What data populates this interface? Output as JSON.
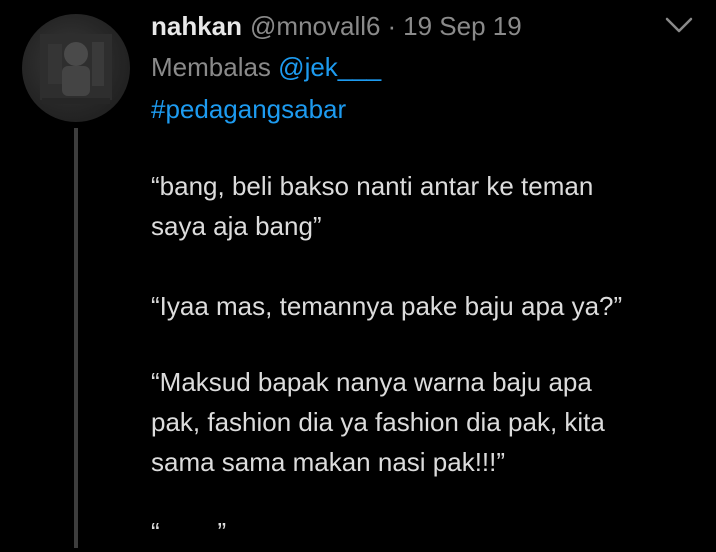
{
  "tweet": {
    "display_name": "nahkan",
    "handle": "@mnovall6",
    "separator": "·",
    "date": "19 Sep 19",
    "reply_prefix": "Membalas",
    "reply_to": "@jek___",
    "hashtag": "#pedagangsabar",
    "paragraphs": [
      [
        "“bang, beli bakso nanti antar ke teman",
        "saya aja bang”"
      ],
      [
        "“Iyaa mas, temannya pake baju apa ya?”"
      ],
      [
        "“Maksud bapak nanya warna baju apa",
        "pak, fashion dia ya fashion dia pak, kita",
        "sama sama makan nasi pak!!!”"
      ],
      [
        "“        ”"
      ]
    ]
  },
  "icons": {
    "more": "chevron-down-icon",
    "avatar": "user-avatar"
  },
  "colors": {
    "background": "#000000",
    "link": "#1d9bf0",
    "muted": "#8a8a8a",
    "text": "#dcdcdc",
    "thread_line": "#3d3d3d"
  }
}
